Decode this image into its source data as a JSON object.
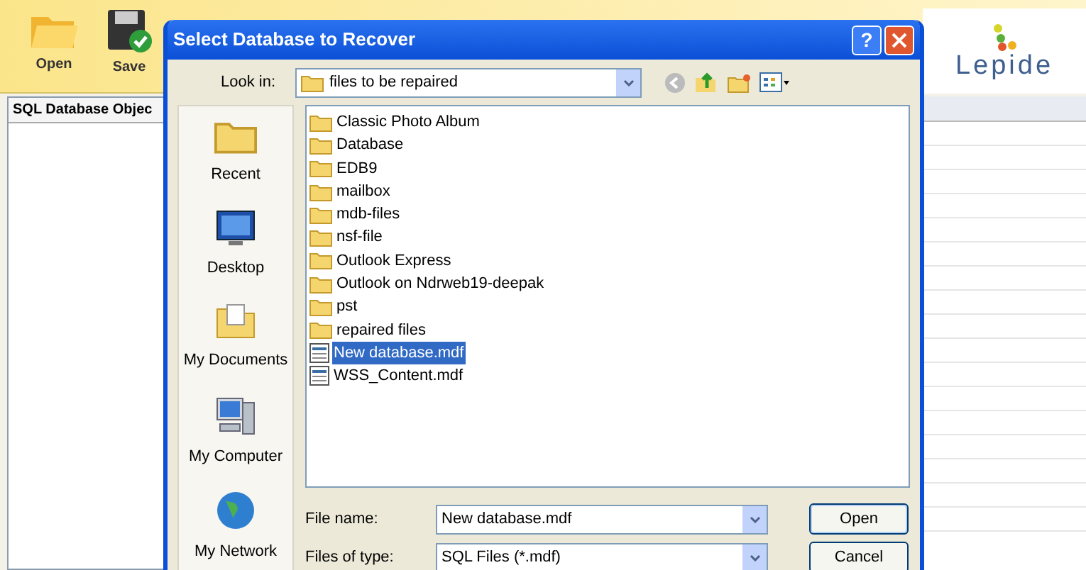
{
  "app": {
    "toolbar": [
      {
        "label": "Open",
        "kind": "open"
      },
      {
        "label": "Save",
        "kind": "save"
      }
    ],
    "logo": "Lepide",
    "left_panel": {
      "header": "SQL Database Objec"
    }
  },
  "dialog": {
    "title": "Select Database to Recover",
    "look_in": {
      "label": "Look in:",
      "value": "files to be repaired"
    },
    "places": [
      {
        "label": "Recent",
        "kind": "recent"
      },
      {
        "label": "Desktop",
        "kind": "desktop"
      },
      {
        "label": "My Documents",
        "kind": "documents"
      },
      {
        "label": "My Computer",
        "kind": "computer"
      },
      {
        "label": "My Network",
        "kind": "network"
      }
    ],
    "files": [
      {
        "name": "Classic Photo Album",
        "kind": "folder",
        "selected": false
      },
      {
        "name": "Database",
        "kind": "folder",
        "selected": false
      },
      {
        "name": "EDB9",
        "kind": "folder",
        "selected": false
      },
      {
        "name": "mailbox",
        "kind": "folder",
        "selected": false
      },
      {
        "name": "mdb-files",
        "kind": "folder",
        "selected": false
      },
      {
        "name": "nsf-file",
        "kind": "folder",
        "selected": false
      },
      {
        "name": "Outlook Express",
        "kind": "folder",
        "selected": false
      },
      {
        "name": "Outlook on Ndrweb19-deepak",
        "kind": "folder",
        "selected": false
      },
      {
        "name": "pst",
        "kind": "folder",
        "selected": false
      },
      {
        "name": "repaired files",
        "kind": "folder",
        "selected": false
      },
      {
        "name": "New database.mdf",
        "kind": "file",
        "selected": true
      },
      {
        "name": "WSS_Content.mdf",
        "kind": "file",
        "selected": false
      }
    ],
    "file_name": {
      "label": "File name:",
      "value": "New database.mdf"
    },
    "file_type": {
      "label": "Files of type:",
      "value": "SQL Files (*.mdf)"
    },
    "buttons": [
      "Open",
      "Cancel"
    ],
    "help": "?"
  }
}
